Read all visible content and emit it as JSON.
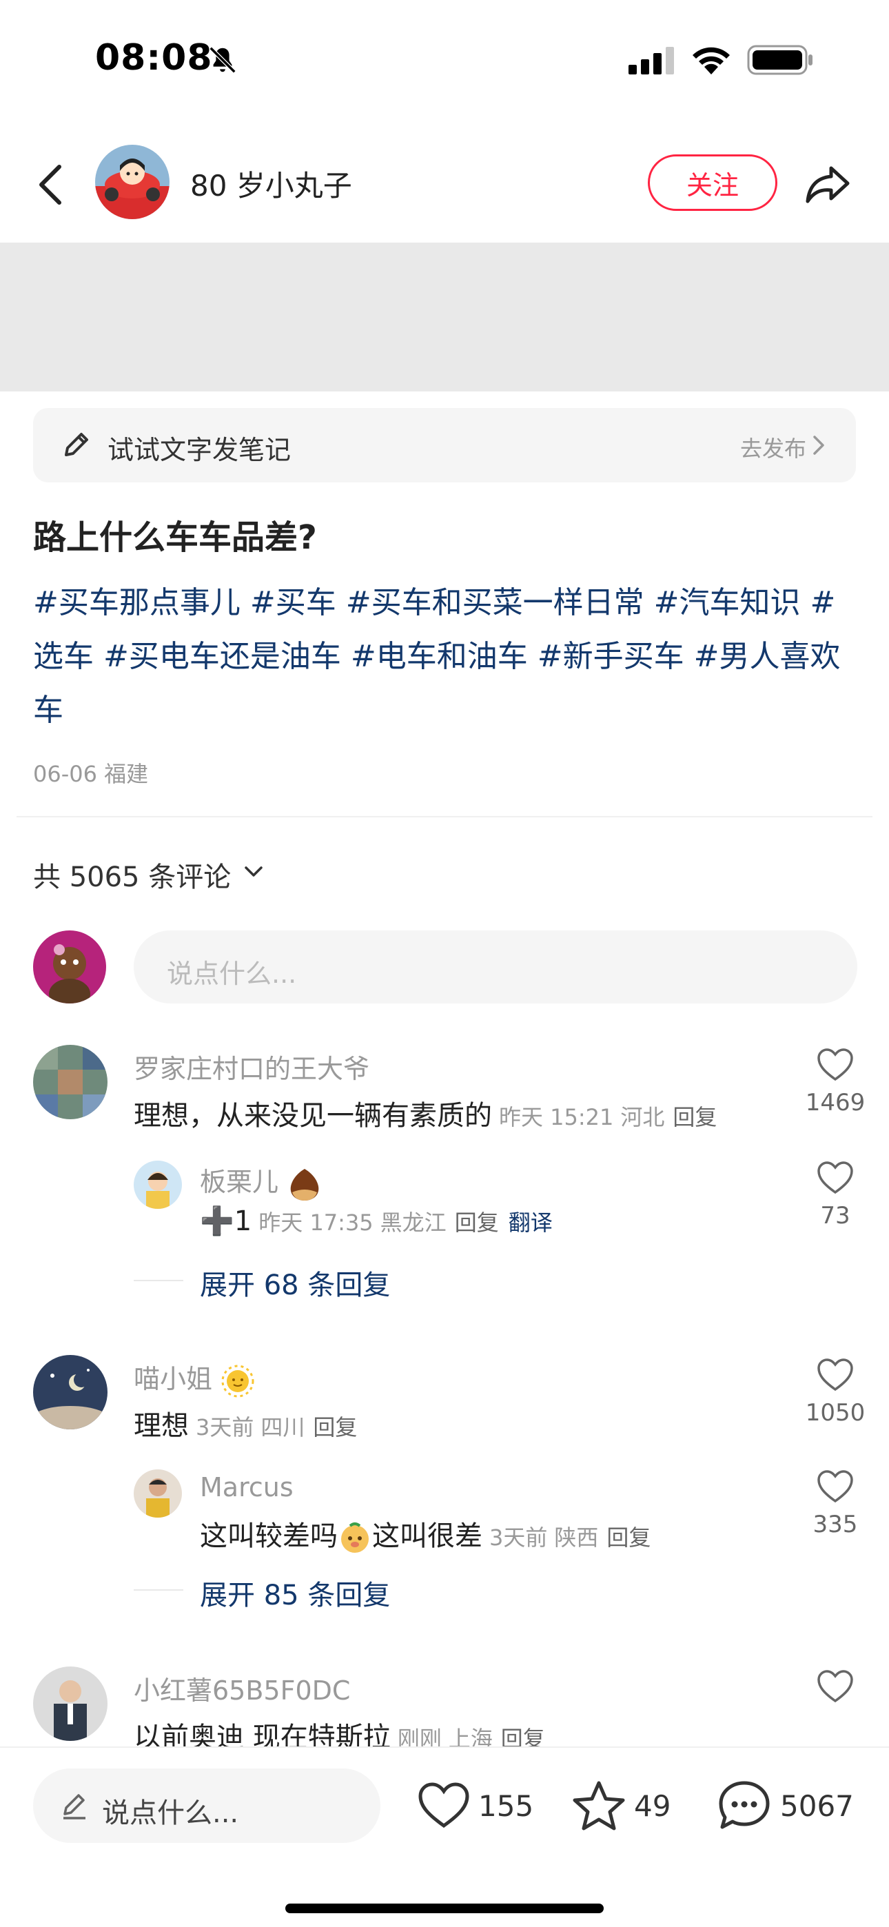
{
  "status_bar": {
    "time": "08:08"
  },
  "header": {
    "author_name": "80 岁小丸子",
    "follow_label": "关注"
  },
  "try_bar": {
    "text": "试试文字发笔记",
    "publish_label": "去发布"
  },
  "note": {
    "title": "路上什么车车品差?",
    "tags": [
      "#买车那点事儿",
      "#买车",
      "#买车和买菜一样日常",
      "#汽车知识",
      "#选车",
      "#买电车还是油车",
      "#电车和油车",
      "#新手买车",
      "#男人喜欢车"
    ],
    "date": "06-06",
    "location": "福建"
  },
  "comments_header": {
    "count_label": "共 5065 条评论",
    "input_placeholder": "说点什么..."
  },
  "comments": [
    {
      "name": "罗家庄村口的王大爷",
      "text": "理想，从来没见一辆有素质的",
      "time": "昨天 15:21",
      "location": "河北",
      "reply_label": "回复",
      "likes": "1469",
      "reply": {
        "name": "板栗儿",
        "text": "➕1",
        "time": "昨天 17:35",
        "location": "黑龙江",
        "reply_label": "回复",
        "translate_label": "翻译",
        "likes": "73"
      },
      "expand_label": "展开 68 条回复"
    },
    {
      "name": "喵小姐",
      "text": "理想",
      "time": "3天前",
      "location": "四川",
      "reply_label": "回复",
      "likes": "1050",
      "reply": {
        "name": "Marcus",
        "text_before": "这叫较差吗",
        "text_after": "这叫很差",
        "time": "3天前",
        "location": "陕西",
        "reply_label": "回复",
        "likes": "335"
      },
      "expand_label": "展开 85 条回复"
    },
    {
      "name": "小红薯65B5F0DC",
      "text": "以前奥迪 现在特斯拉",
      "time": "刚刚",
      "location": "上海",
      "reply_label": "回复"
    }
  ],
  "bottom_bar": {
    "input_placeholder": "说点什么...",
    "likes": "155",
    "collects": "49",
    "comments": "5067"
  },
  "colors": {
    "accent": "#ff2442",
    "link": "#13386c",
    "muted": "#999999"
  },
  "icons": [
    "bell-off-icon",
    "signal-icon",
    "wifi-icon",
    "battery-icon",
    "back-icon",
    "share-icon",
    "pencil-icon",
    "chevron-right-icon",
    "chevron-down-icon",
    "heart-icon",
    "star-icon",
    "comment-icon"
  ]
}
